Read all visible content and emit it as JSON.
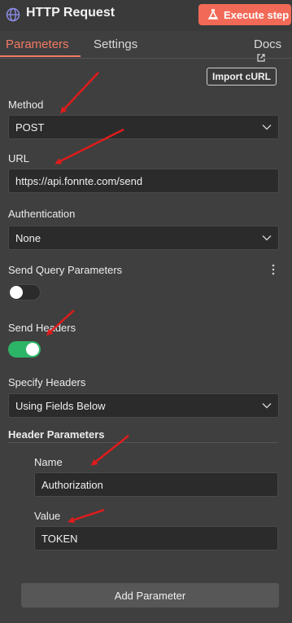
{
  "header": {
    "title": "HTTP Request",
    "node_icon": "globe-icon",
    "execute_label": "Execute step"
  },
  "tabs": [
    {
      "label": "Parameters",
      "active": true
    },
    {
      "label": "Settings",
      "active": false
    },
    {
      "label": "Docs",
      "active": false
    }
  ],
  "import_label": "Import cURL",
  "method": {
    "label": "Method",
    "value": "POST"
  },
  "url": {
    "label": "URL",
    "value": "https://api.fonnte.com/send"
  },
  "authentication": {
    "label": "Authentication",
    "value": "None"
  },
  "send_query": {
    "label": "Send Query Parameters",
    "enabled": false
  },
  "send_headers": {
    "label": "Send Headers",
    "enabled": true
  },
  "specify_headers": {
    "label": "Specify Headers",
    "value": "Using Fields Below"
  },
  "header_params": {
    "label": "Header Parameters",
    "name_label": "Name",
    "name_value": "Authorization",
    "value_label": "Value",
    "value_value": "TOKEN"
  },
  "add_parameter_label": "Add Parameter",
  "colors": {
    "accent": "#f26a57",
    "toggle_on": "#2db567",
    "annotation_arrow": "#e01b1b"
  }
}
